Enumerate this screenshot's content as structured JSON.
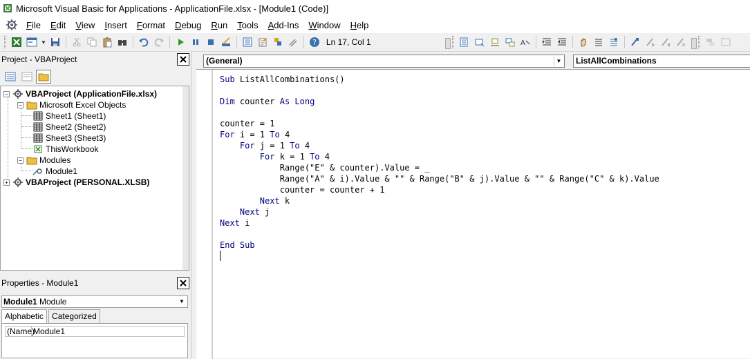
{
  "window": {
    "title": "Microsoft Visual Basic for Applications - ApplicationFile.xlsx - [Module1 (Code)]"
  },
  "menu": {
    "items": [
      {
        "key": "F",
        "rest": "ile"
      },
      {
        "key": "E",
        "rest": "dit"
      },
      {
        "key": "V",
        "rest": "iew"
      },
      {
        "key": "I",
        "rest": "nsert"
      },
      {
        "key": "F",
        "rest": "ormat"
      },
      {
        "key": "D",
        "rest": "ebug"
      },
      {
        "key": "R",
        "rest": "un"
      },
      {
        "key": "T",
        "rest": "ools"
      },
      {
        "key": "A",
        "rest": "dd-Ins"
      },
      {
        "key": "W",
        "rest": "indow"
      },
      {
        "key": "H",
        "rest": "elp"
      }
    ]
  },
  "toolbar": {
    "position": "Ln 17, Col 1"
  },
  "project": {
    "title": "Project - VBAProject",
    "tree": [
      {
        "label": "VBAProject (ApplicationFile.xlsx)",
        "bold": true,
        "icon": "vba-project-icon",
        "expander": "−"
      },
      {
        "label": "Microsoft Excel Objects",
        "bold": false,
        "icon": "folder-icon",
        "expander": "−"
      },
      {
        "label": "Sheet1 (Sheet1)",
        "bold": false,
        "icon": "sheet-icon",
        "expander": ""
      },
      {
        "label": "Sheet2 (Sheet2)",
        "bold": false,
        "icon": "sheet-icon",
        "expander": ""
      },
      {
        "label": "Sheet3 (Sheet3)",
        "bold": false,
        "icon": "sheet-icon",
        "expander": ""
      },
      {
        "label": "ThisWorkbook",
        "bold": false,
        "icon": "workbook-icon",
        "expander": ""
      },
      {
        "label": "Modules",
        "bold": false,
        "icon": "folder-icon",
        "expander": "−"
      },
      {
        "label": "Module1",
        "bold": false,
        "icon": "module-icon",
        "expander": ""
      },
      {
        "label": "VBAProject (PERSONAL.XLSB)",
        "bold": true,
        "icon": "vba-project-icon",
        "expander": "+"
      }
    ]
  },
  "properties": {
    "title": "Properties - Module1",
    "object_name": "Module1",
    "object_type": "Module",
    "tabs": [
      "Alphabetic",
      "Categorized"
    ],
    "rows": [
      {
        "name": "(Name)",
        "value": "Module1"
      }
    ]
  },
  "code": {
    "object_combo": "(General)",
    "proc_combo": "ListAllCombinations",
    "lines": [
      "Sub ListAllCombinations()",
      "",
      "Dim counter As Long",
      "",
      "counter = 1",
      "For i = 1 To 4",
      "    For j = 1 To 4",
      "        For k = 1 To 4",
      "            Range(\"E\" & counter).Value = _",
      "            Range(\"A\" & i).Value & \"\" & Range(\"B\" & j).Value & \"\" & Range(\"C\" & k).Value",
      "            counter = counter + 1",
      "        Next k",
      "    Next j",
      "Next i",
      "",
      "End Sub"
    ],
    "keyword_color": "#00007f"
  }
}
